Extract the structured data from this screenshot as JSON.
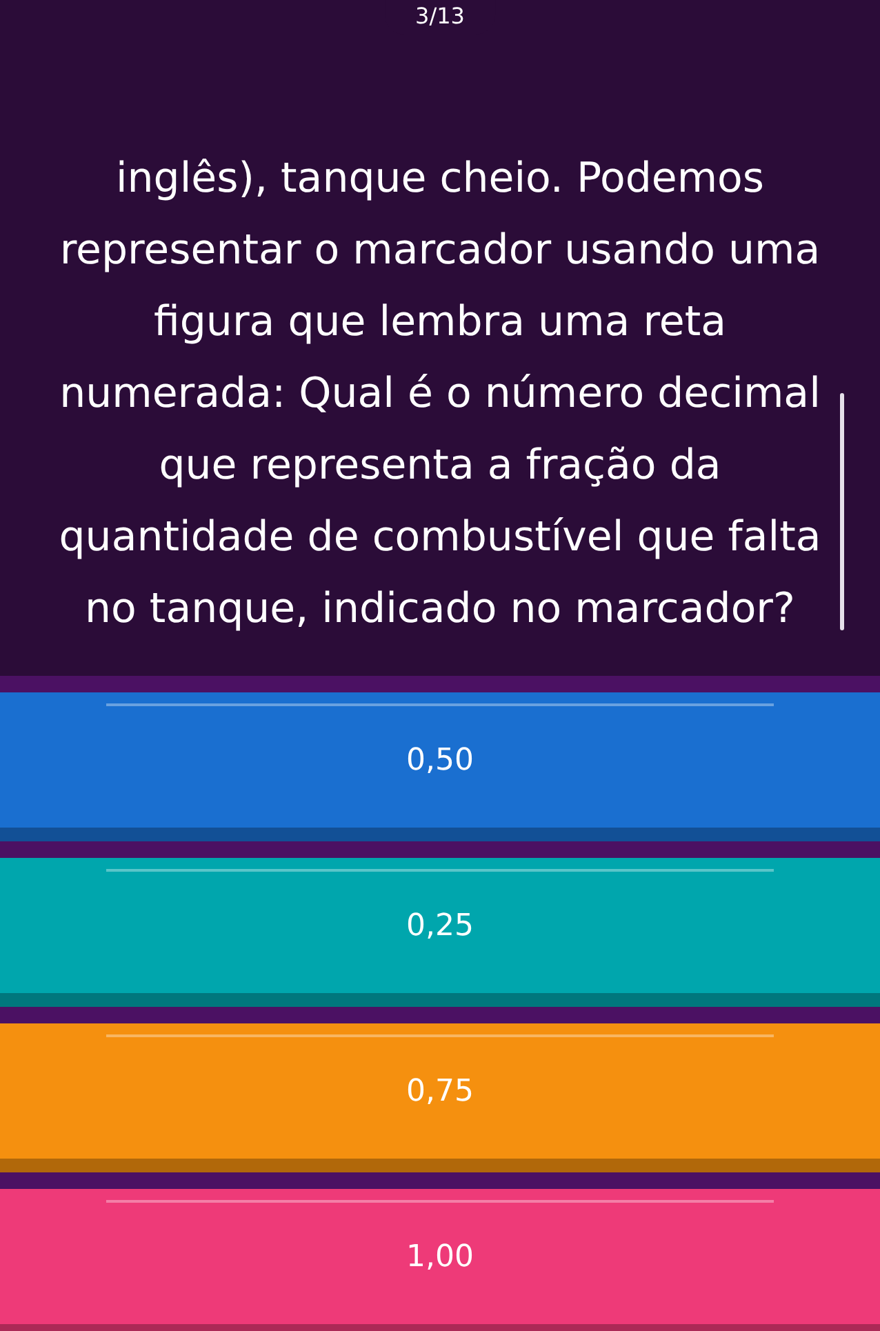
{
  "progress": "3/13",
  "question": "inglês), tanque cheio. Podemos representar o marcador usando uma figura que lembra uma reta numerada: Qual é o número decimal que representa a fração da quantidade de combustível que falta no tanque, indicado no marcador?",
  "answers": [
    {
      "label": "0,50",
      "color": "#1a6fd0"
    },
    {
      "label": "0,25",
      "color": "#00a6ad"
    },
    {
      "label": "0,75",
      "color": "#f5900f"
    },
    {
      "label": "1,00",
      "color": "#ee3a78"
    }
  ]
}
